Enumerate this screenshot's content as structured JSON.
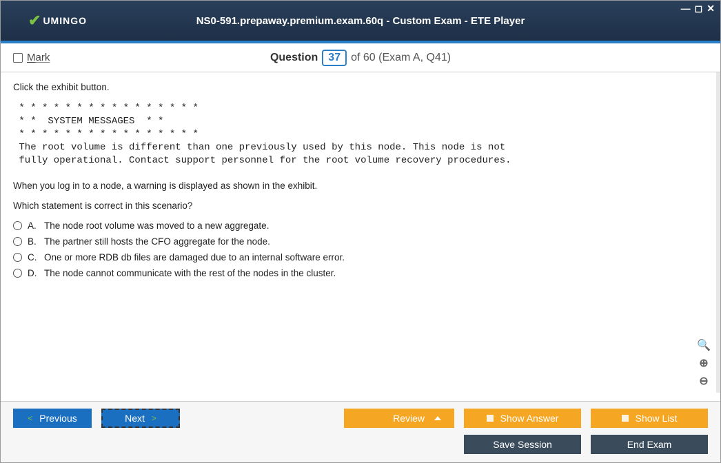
{
  "window": {
    "title": "NS0-591.prepaway.premium.exam.60q - Custom Exam - ETE Player",
    "brand": "UMINGO"
  },
  "header": {
    "mark_label": "Mark",
    "question_word": "Question",
    "current_num": "37",
    "of_text": "of 60 (Exam A, Q41)"
  },
  "content": {
    "instruction": "Click the exhibit button.",
    "exhibit": " * * * * * * * * * * * * * * * *\n * *  SYSTEM MESSAGES  * *\n * * * * * * * * * * * * * * * *\n The root volume is different than one previously used by this node. This node is not\n fully operational. Contact support personnel for the root volume recovery procedures.",
    "scenario": "When you log in to a node, a warning is displayed as shown in the exhibit.",
    "question": "Which statement is correct in this scenario?",
    "options": [
      {
        "letter": "A.",
        "text": "The node root volume was moved to a new aggregate."
      },
      {
        "letter": "B.",
        "text": "The partner still hosts the CFO aggregate for the node."
      },
      {
        "letter": "C.",
        "text": "One or more RDB db files are damaged due to an internal software error."
      },
      {
        "letter": "D.",
        "text": "The node cannot communicate with the rest of the nodes in the cluster."
      }
    ]
  },
  "footer": {
    "previous": "Previous",
    "next": "Next",
    "review": "Review",
    "show_answer": "Show Answer",
    "show_list": "Show List",
    "save_session": "Save Session",
    "end_exam": "End Exam"
  }
}
